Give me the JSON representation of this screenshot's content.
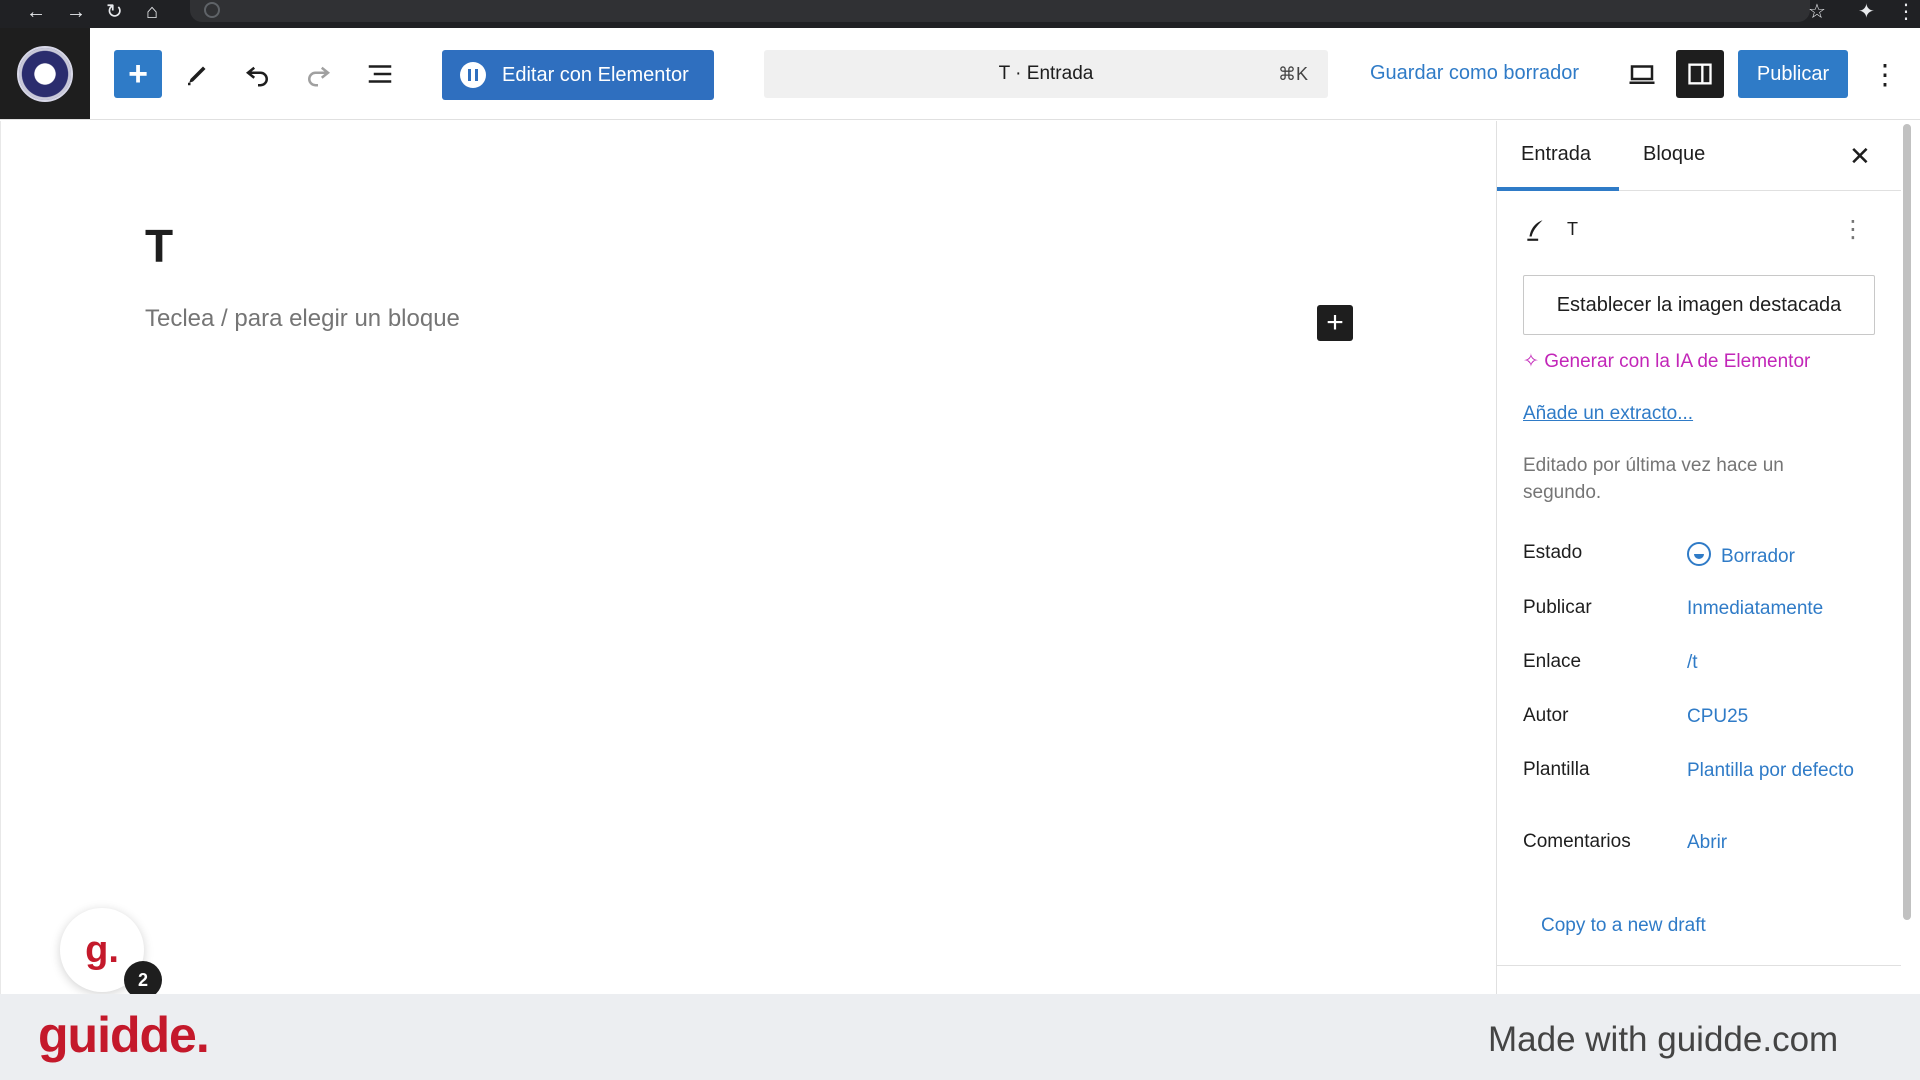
{
  "editor": {
    "elementor_button_label": "Editar con Elementor",
    "command_bar_title": "T · Entrada",
    "command_bar_shortcut": "⌘K",
    "save_draft_label": "Guardar como borrador",
    "publish_label": "Publicar"
  },
  "canvas": {
    "post_title": "T",
    "block_placeholder": "Teclea / para elegir un bloque"
  },
  "sidebar": {
    "tabs": [
      {
        "label": "Entrada",
        "active": true
      },
      {
        "label": "Bloque",
        "active": false
      }
    ],
    "summary_title": "T",
    "featured_image_button": "Establecer la imagen destacada",
    "ai_link": "Generar con la IA de Elementor",
    "excerpt_link": "Añade un extracto...",
    "last_edited": "Editado por última vez hace un segundo.",
    "meta": [
      {
        "label": "Estado",
        "value": "Borrador"
      },
      {
        "label": "Publicar",
        "value": "Inmediatamente"
      },
      {
        "label": "Enlace",
        "value": "/t"
      },
      {
        "label": "Autor",
        "value": "CPU25"
      },
      {
        "label": "Plantilla",
        "value": "Plantilla por defecto"
      },
      {
        "label": "Comentarios",
        "value": "Abrir"
      }
    ],
    "copy_draft": "Copy to a new draft"
  },
  "guidde": {
    "bubble_letter": "g.",
    "badge_count": "2",
    "footer_logo": "guidde.",
    "footer_text": "Made with guidde.com"
  },
  "colors": {
    "accent": "#2f7bc7",
    "ai_accent": "#c226b8",
    "guidde_red": "#c4192b"
  }
}
